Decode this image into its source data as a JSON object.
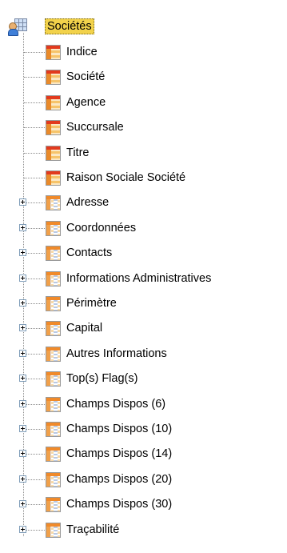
{
  "tree": {
    "root": {
      "label": "Sociétés",
      "icon": "table-user-icon",
      "expanded": true,
      "selected": true
    },
    "items": [
      {
        "label": "Indice",
        "type": "field",
        "icon": "field-table-icon",
        "expandable": false
      },
      {
        "label": "Société",
        "type": "field",
        "icon": "field-table-icon",
        "expandable": false
      },
      {
        "label": "Agence",
        "type": "field",
        "icon": "field-table-icon",
        "expandable": false
      },
      {
        "label": "Succursale",
        "type": "field",
        "icon": "field-table-icon",
        "expandable": false
      },
      {
        "label": "Titre",
        "type": "field",
        "icon": "field-table-icon",
        "expandable": false
      },
      {
        "label": "Raison Sociale Société",
        "type": "field",
        "icon": "field-table-icon",
        "expandable": false
      },
      {
        "label": "Adresse",
        "type": "group",
        "icon": "group-table-icon",
        "expandable": true
      },
      {
        "label": "Coordonnées",
        "type": "group",
        "icon": "group-table-icon",
        "expandable": true
      },
      {
        "label": "Contacts",
        "type": "group",
        "icon": "group-table-icon",
        "expandable": true
      },
      {
        "label": "Informations Administratives",
        "type": "group",
        "icon": "group-table-icon",
        "expandable": true
      },
      {
        "label": "Périmètre",
        "type": "group",
        "icon": "group-table-icon",
        "expandable": true
      },
      {
        "label": "Capital",
        "type": "group",
        "icon": "group-table-icon",
        "expandable": true
      },
      {
        "label": "Autres Informations",
        "type": "group",
        "icon": "group-table-icon",
        "expandable": true
      },
      {
        "label": "Top(s) Flag(s)",
        "type": "group",
        "icon": "group-table-icon",
        "expandable": true
      },
      {
        "label": "Champs Dispos (6)",
        "type": "group",
        "icon": "group-table-icon",
        "expandable": true
      },
      {
        "label": "Champs Dispos (10)",
        "type": "group",
        "icon": "group-table-icon",
        "expandable": true
      },
      {
        "label": "Champs Dispos (14)",
        "type": "group",
        "icon": "group-table-icon",
        "expandable": true
      },
      {
        "label": "Champs Dispos (20)",
        "type": "group",
        "icon": "group-table-icon",
        "expandable": true
      },
      {
        "label": "Champs Dispos (30)",
        "type": "group",
        "icon": "group-table-icon",
        "expandable": true
      },
      {
        "label": "Traçabilité",
        "type": "group",
        "icon": "group-table-icon",
        "expandable": true
      }
    ]
  }
}
